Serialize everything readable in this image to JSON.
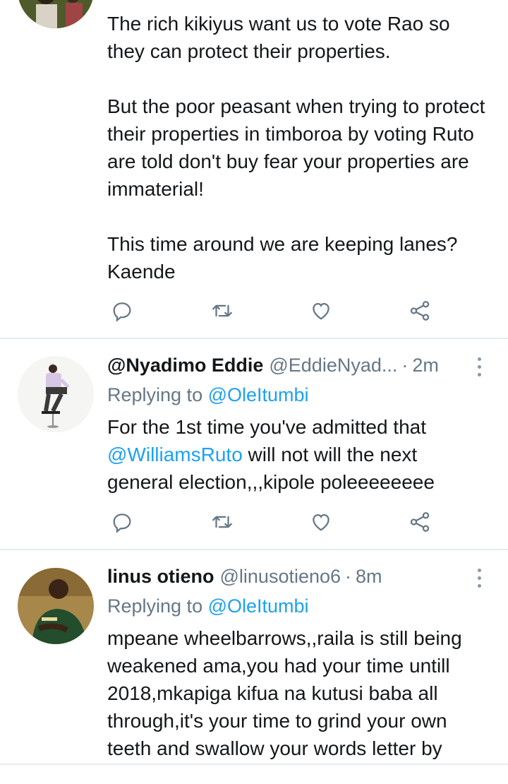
{
  "tweets": [
    {
      "body": [
        "The rich kikiyus want us to vote Rao so they can protect their properties.",
        "",
        "But the  poor peasant when trying to protect their properties in timboroa  by voting Ruto are told don't buy fear your properties are immaterial!",
        "",
        "This time around we are keeping lanes? Kaende"
      ]
    },
    {
      "name": "@Nyadimo Eddie",
      "handle": "@EddieNyad...",
      "dot": "·",
      "time": "2m",
      "replying_prefix": "Replying to ",
      "replying_to": "@OleItumbi",
      "body_mention": "@WilliamsRuto",
      "body_before": "For the 1st time you've admitted that ",
      "body_after": " will not will the next general election,,,kipole poleeeeeeee"
    },
    {
      "name": "linus otieno",
      "handle": "@linusotieno6",
      "dot": "·",
      "time": "8m",
      "replying_prefix": "Replying to ",
      "replying_to": "@OleItumbi",
      "body": "mpeane wheelbarrows,,raila is still being weakened ama,you had your time untill 2018,mkapiga kifua na kutusi baba all through,it's your time to grind your own teeth and swallow your words letter by"
    }
  ],
  "icons": {
    "reply": "reply-icon",
    "retweet": "retweet-icon",
    "like": "like-icon",
    "share": "share-icon",
    "more": "more-options-icon"
  },
  "colors": {
    "link": "#1da1f2",
    "secondary_text": "#657786",
    "divider": "#e6ecf0"
  }
}
